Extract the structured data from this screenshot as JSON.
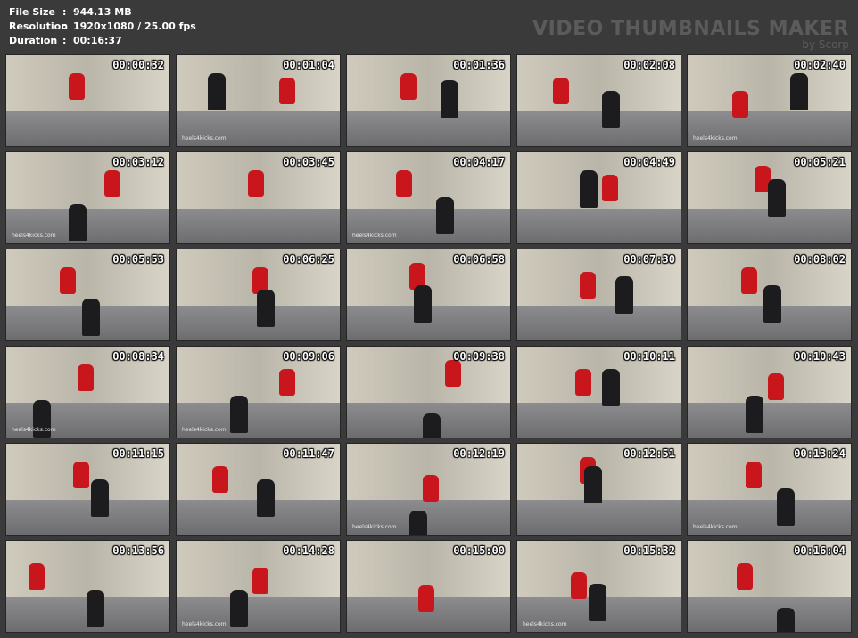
{
  "info": {
    "file_size_label": "File Size",
    "file_size_value": "944.13 MB",
    "resolution_label": "Resolution",
    "resolution_value": "1920x1080 / 25.00 fps",
    "duration_label": "Duration",
    "duration_value": "00:16:37",
    "separator": ":"
  },
  "brand": {
    "title": "VIDEO THUMBNAILS MAKER",
    "subtitle": "by Scorp"
  },
  "watermark": "heels4kicks.com",
  "thumbnails": [
    "00:00:32",
    "00:01:04",
    "00:01:36",
    "00:02:08",
    "00:02:40",
    "00:03:12",
    "00:03:45",
    "00:04:17",
    "00:04:49",
    "00:05:21",
    "00:05:53",
    "00:06:25",
    "00:06:58",
    "00:07:30",
    "00:08:02",
    "00:08:34",
    "00:09:06",
    "00:09:38",
    "00:10:11",
    "00:10:43",
    "00:11:15",
    "00:11:47",
    "00:12:19",
    "00:12:51",
    "00:13:24",
    "00:13:56",
    "00:14:28",
    "00:15:00",
    "00:15:32",
    "00:16:04"
  ],
  "watermark_visible": [
    false,
    true,
    false,
    false,
    true,
    true,
    false,
    true,
    false,
    false,
    false,
    false,
    false,
    false,
    false,
    true,
    true,
    false,
    false,
    false,
    false,
    false,
    true,
    false,
    true,
    false,
    true,
    false,
    true,
    false
  ]
}
